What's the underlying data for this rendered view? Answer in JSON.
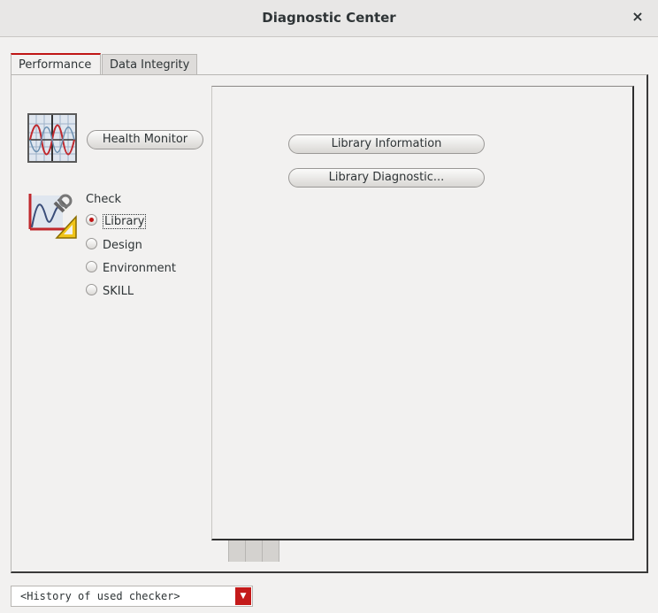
{
  "window": {
    "title": "Diagnostic Center",
    "close_glyph": "×"
  },
  "tabs": [
    {
      "label": "Performance",
      "active": true
    },
    {
      "label": "Data Integrity",
      "active": false
    }
  ],
  "left": {
    "health_monitor_icon": "waveform-monitor-icon",
    "health_monitor_label": "Health Monitor",
    "check_icon": "graph-tools-icon",
    "check_label": "Check",
    "options": [
      "Library",
      "Design",
      "Environment",
      "SKILL"
    ],
    "selected": "Library"
  },
  "right": {
    "library_information": "Library Information",
    "library_diagnostic": "Library Diagnostic..."
  },
  "history": {
    "value": "<History of used checker>",
    "arrow_glyph": "▼"
  },
  "colors": {
    "accent": "#c01515",
    "background": "#f2f1f0"
  }
}
